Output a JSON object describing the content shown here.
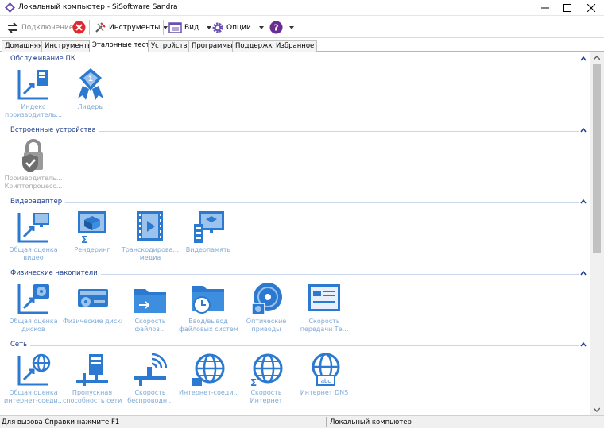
{
  "window": {
    "title": "Локальный компьютер - SiSoftware Sandra"
  },
  "toolbar": {
    "connect_label": "Подключение",
    "tools_label": "Инструменты",
    "view_label": "Вид",
    "options_label": "Опции"
  },
  "tabs": [
    {
      "label": "Домашняя"
    },
    {
      "label": "Инструменты"
    },
    {
      "label": "Эталонные тесты"
    },
    {
      "label": "Устройства"
    },
    {
      "label": "Программы"
    },
    {
      "label": "Поддержка"
    },
    {
      "label": "Избранное"
    }
  ],
  "groups": [
    {
      "title": "Обслуживание ПК",
      "items": [
        {
          "line1": "Индекс",
          "line2": "производитель..."
        },
        {
          "line1": "Лидеры",
          "line2": ""
        }
      ]
    },
    {
      "title": "Встроенные устройства",
      "items": [
        {
          "line1": "Производитель...",
          "line2": "Криптопроцесс..."
        }
      ]
    },
    {
      "title": "Видеоадаптер",
      "items": [
        {
          "line1": "Общая оценка",
          "line2": "видео"
        },
        {
          "line1": "Рендеринг",
          "line2": ""
        },
        {
          "line1": "Транскодирова...",
          "line2": "медиа"
        },
        {
          "line1": "Видеопамять",
          "line2": ""
        }
      ]
    },
    {
      "title": "Физические накопители",
      "items": [
        {
          "line1": "Общая оценка",
          "line2": "дисков"
        },
        {
          "line1": "Физические диски",
          "line2": ""
        },
        {
          "line1": "Скорость",
          "line2": "файлов..."
        },
        {
          "line1": "Ввод/вывод",
          "line2": "файловых систем"
        },
        {
          "line1": "Оптические",
          "line2": "приводы"
        },
        {
          "line1": "Скорость",
          "line2": "передачи Те..."
        }
      ]
    },
    {
      "title": "Сеть",
      "items": [
        {
          "line1": "Общая оценка",
          "line2": "интернет-соеди..."
        },
        {
          "line1": "Пропускная",
          "line2": "способность сети"
        },
        {
          "line1": "Скорость",
          "line2": "беспроводн..."
        },
        {
          "line1": "Интернет-соеди...",
          "line2": ""
        },
        {
          "line1": "Скорость",
          "line2": "Интернет"
        },
        {
          "line1": "Интернет DNS",
          "line2": ""
        }
      ]
    }
  ],
  "statusbar": {
    "help_text": "Для вызова Справки нажмите F1",
    "computer": "Локальный компьютер"
  },
  "colors": {
    "accent": "#2b79d0",
    "label": "#7faad6",
    "group_title": "#1f3f8f"
  }
}
